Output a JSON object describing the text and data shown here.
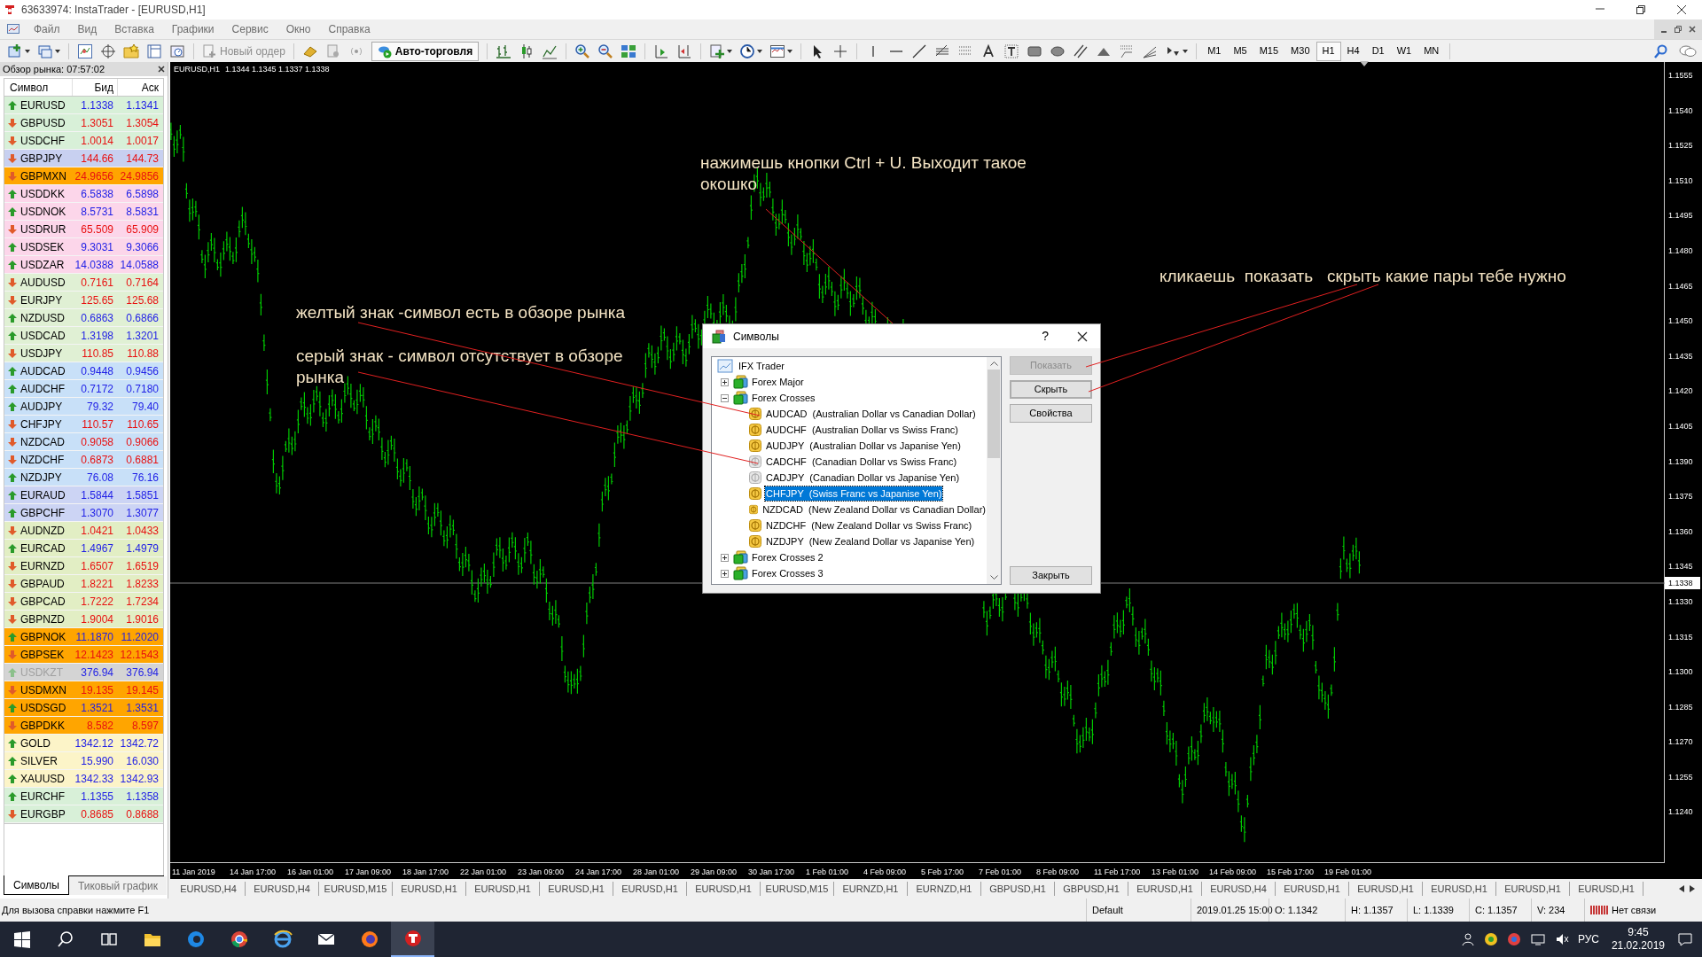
{
  "window": {
    "title": "63633974: InstaTrader - [EURUSD,H1]"
  },
  "menu": [
    "Файл",
    "Вид",
    "Вставка",
    "Графики",
    "Сервис",
    "Окно",
    "Справка"
  ],
  "toolbar": {
    "new_order": {
      "label": "Новый ордер",
      "disabled": true
    },
    "auto_trading": {
      "label": "Авто-торговля"
    },
    "timeframes": [
      {
        "label": "M1",
        "selected": false
      },
      {
        "label": "M5",
        "selected": false
      },
      {
        "label": "M15",
        "selected": false
      },
      {
        "label": "M30",
        "selected": false
      },
      {
        "label": "H1",
        "selected": true
      },
      {
        "label": "H4",
        "selected": false
      },
      {
        "label": "D1",
        "selected": false
      },
      {
        "label": "W1",
        "selected": false
      },
      {
        "label": "MN",
        "selected": false
      }
    ]
  },
  "market_watch": {
    "title": "Обзор рынка: 07:57:02",
    "columns": [
      "Символ",
      "Бид",
      "Аск"
    ],
    "rows": [
      {
        "symbol": "EURUSD",
        "bid": "1.1338",
        "ask": "1.1341",
        "rising": true,
        "color": "#d8f0d8",
        "disabled": false
      },
      {
        "symbol": "GBPUSD",
        "bid": "1.3051",
        "ask": "1.3054",
        "rising": false,
        "color": "#d8f0d8",
        "disabled": false
      },
      {
        "symbol": "USDCHF",
        "bid": "1.0014",
        "ask": "1.0017",
        "rising": false,
        "color": "#d8f0d8",
        "disabled": false
      },
      {
        "symbol": "GBPJPY",
        "bid": "144.66",
        "ask": "144.73",
        "rising": false,
        "color": "#c8d0f0",
        "disabled": false
      },
      {
        "symbol": "GBPMXN",
        "bid": "24.9656",
        "ask": "24.9856",
        "rising": false,
        "color": "#ffa500",
        "disabled": false
      },
      {
        "symbol": "USDDKK",
        "bid": "6.5838",
        "ask": "6.5898",
        "rising": true,
        "color": "#fcd6ea",
        "disabled": false
      },
      {
        "symbol": "USDNOK",
        "bid": "8.5731",
        "ask": "8.5831",
        "rising": true,
        "color": "#fcd6ea",
        "disabled": false
      },
      {
        "symbol": "USDRUR",
        "bid": "65.509",
        "ask": "65.909",
        "rising": false,
        "color": "#fcd6ea",
        "disabled": false
      },
      {
        "symbol": "USDSEK",
        "bid": "9.3031",
        "ask": "9.3066",
        "rising": true,
        "color": "#fcd6ea",
        "disabled": false
      },
      {
        "symbol": "USDZAR",
        "bid": "14.0388",
        "ask": "14.0588",
        "rising": true,
        "color": "#fcd6ea",
        "disabled": false
      },
      {
        "symbol": "AUDUSD",
        "bid": "0.7161",
        "ask": "0.7164",
        "rising": false,
        "color": "#e0f0d4",
        "disabled": false
      },
      {
        "symbol": "EURJPY",
        "bid": "125.65",
        "ask": "125.68",
        "rising": false,
        "color": "#e0f0d4",
        "disabled": false
      },
      {
        "symbol": "NZDUSD",
        "bid": "0.6863",
        "ask": "0.6866",
        "rising": true,
        "color": "#e0f0d4",
        "disabled": false
      },
      {
        "symbol": "USDCAD",
        "bid": "1.3198",
        "ask": "1.3201",
        "rising": true,
        "color": "#e0f0d4",
        "disabled": false
      },
      {
        "symbol": "USDJPY",
        "bid": "110.85",
        "ask": "110.88",
        "rising": false,
        "color": "#e0f0d4",
        "disabled": false
      },
      {
        "symbol": "AUDCAD",
        "bid": "0.9448",
        "ask": "0.9456",
        "rising": true,
        "color": "#c8e0f8",
        "disabled": false
      },
      {
        "symbol": "AUDCHF",
        "bid": "0.7172",
        "ask": "0.7180",
        "rising": true,
        "color": "#c8e0f8",
        "disabled": false
      },
      {
        "symbol": "AUDJPY",
        "bid": "79.32",
        "ask": "79.40",
        "rising": true,
        "color": "#c8e0f8",
        "disabled": false
      },
      {
        "symbol": "CHFJPY",
        "bid": "110.57",
        "ask": "110.65",
        "rising": false,
        "color": "#c8e0f8",
        "disabled": false
      },
      {
        "symbol": "NZDCAD",
        "bid": "0.9058",
        "ask": "0.9066",
        "rising": false,
        "color": "#c8e0f8",
        "disabled": false
      },
      {
        "symbol": "NZDCHF",
        "bid": "0.6873",
        "ask": "0.6881",
        "rising": false,
        "color": "#c8e0f8",
        "disabled": false
      },
      {
        "symbol": "NZDJPY",
        "bid": "76.08",
        "ask": "76.16",
        "rising": true,
        "color": "#c8e0f8",
        "disabled": false
      },
      {
        "symbol": "EURAUD",
        "bid": "1.5844",
        "ask": "1.5851",
        "rising": true,
        "color": "#ccd4f4",
        "disabled": false
      },
      {
        "symbol": "GBPCHF",
        "bid": "1.3070",
        "ask": "1.3077",
        "rising": true,
        "color": "#ccd4f4",
        "disabled": false
      },
      {
        "symbol": "AUDNZD",
        "bid": "1.0421",
        "ask": "1.0433",
        "rising": false,
        "color": "#e2eec4",
        "disabled": false
      },
      {
        "symbol": "EURCAD",
        "bid": "1.4967",
        "ask": "1.4979",
        "rising": true,
        "color": "#e2eec4",
        "disabled": false
      },
      {
        "symbol": "EURNZD",
        "bid": "1.6507",
        "ask": "1.6519",
        "rising": false,
        "color": "#e2eec4",
        "disabled": false
      },
      {
        "symbol": "GBPAUD",
        "bid": "1.8221",
        "ask": "1.8233",
        "rising": false,
        "color": "#e2eec4",
        "disabled": false
      },
      {
        "symbol": "GBPCAD",
        "bid": "1.7222",
        "ask": "1.7234",
        "rising": false,
        "color": "#e2eec4",
        "disabled": false
      },
      {
        "symbol": "GBPNZD",
        "bid": "1.9004",
        "ask": "1.9016",
        "rising": false,
        "color": "#e2eec4",
        "disabled": false
      },
      {
        "symbol": "GBPNOK",
        "bid": "11.1870",
        "ask": "11.2020",
        "rising": true,
        "color": "#ffa500",
        "disabled": false
      },
      {
        "symbol": "GBPSEK",
        "bid": "12.1423",
        "ask": "12.1543",
        "rising": false,
        "color": "#ffa500",
        "disabled": false
      },
      {
        "symbol": "USDKZT",
        "bid": "376.94",
        "ask": "376.94",
        "rising": true,
        "color": "#d4d4d4",
        "disabled": true
      },
      {
        "symbol": "USDMXN",
        "bid": "19.135",
        "ask": "19.145",
        "rising": false,
        "color": "#ffa500",
        "disabled": false
      },
      {
        "symbol": "USDSGD",
        "bid": "1.3521",
        "ask": "1.3531",
        "rising": true,
        "color": "#ffa500",
        "disabled": false
      },
      {
        "symbol": "GBPDKK",
        "bid": "8.582",
        "ask": "8.597",
        "rising": false,
        "color": "#ffa500",
        "disabled": false
      },
      {
        "symbol": "GOLD",
        "bid": "1342.12",
        "ask": "1342.72",
        "rising": true,
        "color": "#fcf4c8",
        "disabled": false
      },
      {
        "symbol": "SILVER",
        "bid": "15.990",
        "ask": "16.030",
        "rising": true,
        "color": "#fcf4c8",
        "disabled": false
      },
      {
        "symbol": "XAUUSD",
        "bid": "1342.33",
        "ask": "1342.93",
        "rising": true,
        "color": "#fcf4c8",
        "disabled": false
      },
      {
        "symbol": "EURCHF",
        "bid": "1.1355",
        "ask": "1.1358",
        "rising": true,
        "color": "#d8f0d8",
        "disabled": false
      },
      {
        "symbol": "EURGBP",
        "bid": "0.8685",
        "ask": "0.8688",
        "rising": false,
        "color": "#d8f0d8",
        "disabled": false
      }
    ],
    "tabs": [
      {
        "label": "Символы",
        "selected": true
      },
      {
        "label": "Тиковый график",
        "selected": false
      }
    ]
  },
  "chart": {
    "symbol": "EURUSD,H1",
    "quotes": "1.1344 1.1345 1.1337 1.1338",
    "price_labels": [
      "1.1555",
      "1.1540",
      "1.1525",
      "1.1510",
      "1.1495",
      "1.1480",
      "1.1465",
      "1.1450",
      "1.1435",
      "1.1420",
      "1.1405",
      "1.1390",
      "1.1375",
      "1.1360",
      "1.1345",
      "1.1330",
      "1.1315",
      "1.1300",
      "1.1285",
      "1.1270",
      "1.1255",
      "1.1240"
    ],
    "current_price": "1.1338",
    "time_labels": [
      "11 Jan 2019",
      "14 Jan 17:00",
      "16 Jan 01:00",
      "17 Jan 09:00",
      "18 Jan 17:00",
      "22 Jan 01:00",
      "23 Jan 09:00",
      "24 Jan 17:00",
      "28 Jan 01:00",
      "29 Jan 09:00",
      "30 Jan 17:00",
      "1 Feb 01:00",
      "4 Feb 09:00",
      "5 Feb 17:00",
      "7 Feb 01:00",
      "8 Feb 09:00",
      "11 Feb 17:00",
      "13 Feb 01:00",
      "14 Feb 09:00",
      "15 Feb 17:00",
      "19 Feb 01:00"
    ],
    "notes": [
      "нажимешь кнопки Ctrl + U. Выходит такое окошко",
      "желтый знак -символ есть в обзоре рынка",
      "серый знак - символ отсутствует в обзоре рынка",
      "кликаешь  показать   скрыть какие пары тебе нужно"
    ]
  },
  "chart_tabs": [
    "EURUSD,H4",
    "EURUSD,H4",
    "EURUSD,M15",
    "EURUSD,H1",
    "EURUSD,H1",
    "EURUSD,H1",
    "EURUSD,H1",
    "EURUSD,H1",
    "EURUSD,M15",
    "EURNZD,H1",
    "EURNZD,H1",
    "GBPUSD,H1",
    "GBPUSD,H1",
    "EURUSD,H1",
    "EURUSD,H4",
    "EURUSD,H1",
    "EURUSD,H1",
    "EURUSD,H1",
    "EURUSD,H1",
    "EURUSD,H1"
  ],
  "dialog": {
    "title": "Символы",
    "help": "?",
    "tree": {
      "label": "IFX Trader",
      "children": [
        {
          "label": "Forex Major",
          "expanded": false
        },
        {
          "label": "Forex Crosses",
          "expanded": true,
          "children": [
            {
              "label": "AUDCAD  (Australian Dollar vs Canadian Dollar)",
              "shown": true,
              "selected": false
            },
            {
              "label": "AUDCHF  (Australian Dollar vs Swiss Franc)",
              "shown": true,
              "selected": false
            },
            {
              "label": "AUDJPY  (Australian Dollar vs Japanise Yen)",
              "shown": true,
              "selected": false
            },
            {
              "label": "CADCHF  (Canadian Dollar vs Swiss Franc)",
              "shown": false,
              "selected": false
            },
            {
              "label": "CADJPY  (Canadian Dollar vs Japanise Yen)",
              "shown": false,
              "selected": false
            },
            {
              "label": "CHFJPY  (Swiss Franc vs Japanise Yen)",
              "shown": true,
              "selected": true
            },
            {
              "label": "NZDCAD  (New Zealand Dollar vs Canadian Dollar)",
              "shown": true,
              "selected": false
            },
            {
              "label": "NZDCHF  (New Zealand Dollar vs Swiss Franc)",
              "shown": true,
              "selected": false
            },
            {
              "label": "NZDJPY  (New Zealand Dollar vs Japanise Yen)",
              "shown": true,
              "selected": false
            }
          ]
        },
        {
          "label": "Forex Crosses 2",
          "expanded": false
        },
        {
          "label": "Forex Crosses 3",
          "expanded": false
        }
      ]
    },
    "buttons": [
      {
        "label": "Показать",
        "disabled": true,
        "default": false
      },
      {
        "label": "Скрыть",
        "disabled": false,
        "default": true
      },
      {
        "label": "Свойства",
        "disabled": false,
        "default": false
      },
      {
        "label": "Закрыть",
        "disabled": false,
        "default": false
      }
    ]
  },
  "status_bar": {
    "help": "Для вызова справки нажмите F1",
    "fields": [
      "Default",
      "2019.01.25 15:00",
      "O: 1.1342",
      "H: 1.1357",
      "L: 1.1339",
      "C: 1.1357",
      "V: 234"
    ],
    "connection": "Нет связи"
  },
  "taskbar": {
    "language": "РУС",
    "time": "9:45",
    "date": "21.02.2019"
  }
}
